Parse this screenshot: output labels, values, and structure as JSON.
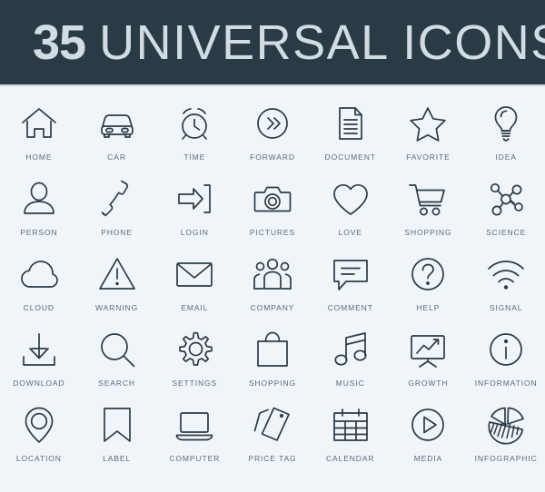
{
  "header": {
    "count": "35",
    "word": "UNIVERSAL ICONS",
    "background_color": "#2b3b46",
    "text_color": "#d2dce3"
  },
  "theme": {
    "page_background": "#f0f5fa",
    "icon_stroke": "#2b3b46",
    "label_color": "#5a6b78"
  },
  "grid": {
    "columns": 7,
    "rows": 5,
    "icons": [
      {
        "icon": "home-icon",
        "label": "HOME"
      },
      {
        "icon": "car-icon",
        "label": "CAR"
      },
      {
        "icon": "alarm-clock-icon",
        "label": "TIME"
      },
      {
        "icon": "forward-chevrons-icon",
        "label": "FORWARD"
      },
      {
        "icon": "document-icon",
        "label": "DOCUMENT"
      },
      {
        "icon": "star-icon",
        "label": "FAVORITE"
      },
      {
        "icon": "lightbulb-icon",
        "label": "IDEA"
      },
      {
        "icon": "person-icon",
        "label": "PERSON"
      },
      {
        "icon": "phone-handset-icon",
        "label": "PHONE"
      },
      {
        "icon": "login-arrow-icon",
        "label": "LOGIN"
      },
      {
        "icon": "camera-icon",
        "label": "PICTURES"
      },
      {
        "icon": "heart-icon",
        "label": "LOVE"
      },
      {
        "icon": "shopping-cart-icon",
        "label": "SHOPPING"
      },
      {
        "icon": "molecule-icon",
        "label": "SCIENCE"
      },
      {
        "icon": "cloud-icon",
        "label": "CLOUD"
      },
      {
        "icon": "warning-triangle-icon",
        "label": "WARNING"
      },
      {
        "icon": "envelope-icon",
        "label": "EMAIL"
      },
      {
        "icon": "people-group-icon",
        "label": "COMPANY"
      },
      {
        "icon": "speech-bubble-icon",
        "label": "COMMENT"
      },
      {
        "icon": "question-circle-icon",
        "label": "HELP"
      },
      {
        "icon": "wifi-signal-icon",
        "label": "SIGNAL"
      },
      {
        "icon": "download-icon",
        "label": "DOWNLOAD"
      },
      {
        "icon": "magnifier-icon",
        "label": "SEARCH"
      },
      {
        "icon": "gear-icon",
        "label": "SETTINGS"
      },
      {
        "icon": "shopping-bag-icon",
        "label": "SHOPPING"
      },
      {
        "icon": "music-note-icon",
        "label": "MUSIC"
      },
      {
        "icon": "growth-chart-icon",
        "label": "GROWTH"
      },
      {
        "icon": "info-circle-icon",
        "label": "INFORMATION"
      },
      {
        "icon": "map-pin-icon",
        "label": "LOCATION"
      },
      {
        "icon": "bookmark-icon",
        "label": "LABEL"
      },
      {
        "icon": "laptop-icon",
        "label": "COMPUTER"
      },
      {
        "icon": "price-tag-icon",
        "label": "PRICE TAG"
      },
      {
        "icon": "calendar-icon",
        "label": "CALENDAR"
      },
      {
        "icon": "play-circle-icon",
        "label": "MEDIA"
      },
      {
        "icon": "pie-chart-icon",
        "label": "INFOGRAPHIC"
      }
    ]
  }
}
